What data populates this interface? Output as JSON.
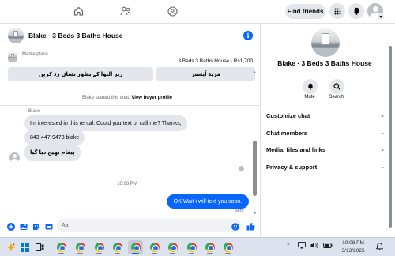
{
  "nav": {
    "find_friends_label": "Find friends"
  },
  "chat": {
    "title": "Blake · 3 Beds 3 Baths House",
    "marketplace_label": "Marketplace",
    "listing": "3 Beds 3 Baths House - Rs1,700",
    "action_left": "زبر النوا کے بطور نشان زد کریں",
    "action_right": "مزید آپشنز",
    "system_name": "Blake",
    "system_text": " started this chat. ",
    "view_profile": "View buyer profile",
    "sender_name": "Blake",
    "messages": [
      "Im interested in this rental.  Could you text or call me?  Thanks,",
      "843-447-9473 blake",
      "پیغام بھیج دیا گیا"
    ],
    "timestamp": "10:08 PM",
    "outgoing": "OK Wait i will text you soon.",
    "sent_label": "Sent",
    "composer_placeholder": "Aa"
  },
  "details": {
    "name": "Blake · 3 Beds 3 Baths House",
    "mute_label": "Mute",
    "search_label": "Search",
    "sections": [
      "Customize chat",
      "Chat members",
      "Media, files and links",
      "Privacy & support"
    ]
  },
  "taskbar": {
    "time": "10:08 PM",
    "date": "3/13/2025"
  },
  "colors": {
    "accent": "#0866ff",
    "bubble_gray": "#e4e6eb",
    "muted_text": "#65676b"
  },
  "icons": [
    "home-icon",
    "friends-icon",
    "groups-icon",
    "menu-grid-icon",
    "messenger-icon",
    "bell-icon",
    "info-icon",
    "plus-circle-icon",
    "image-icon",
    "sticker-icon",
    "gif-icon",
    "emoji-icon",
    "like-icon",
    "search-icon",
    "chrome-icon",
    "windows-start-icon"
  ]
}
